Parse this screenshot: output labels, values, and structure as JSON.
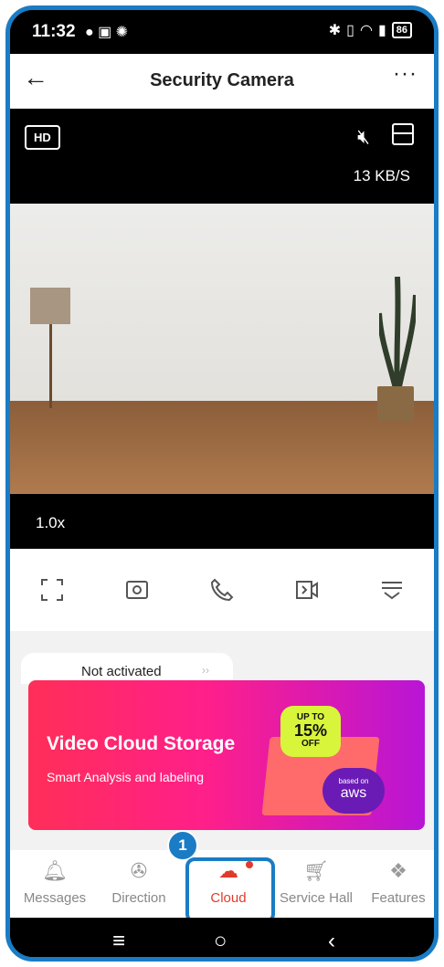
{
  "status_bar": {
    "time": "11:32",
    "battery": "86"
  },
  "header": {
    "title": "Security Camera",
    "back_label": "←",
    "more_label": "···"
  },
  "video": {
    "quality_badge": "HD",
    "bitrate": "13 KB/S",
    "zoom": "1.0x"
  },
  "controls": [
    "fullscreen",
    "screenshot",
    "call",
    "record",
    "more"
  ],
  "cloud_panel": {
    "status": "Not activated",
    "banner_title": "Video Cloud Storage",
    "banner_subtitle": "Smart Analysis and labeling",
    "promo": {
      "line1": "UP TO",
      "line2": "15%",
      "line3": "OFF"
    },
    "partner": {
      "based_on": "based on",
      "name": "aws"
    }
  },
  "bottom_nav": [
    {
      "label": "Messages"
    },
    {
      "label": "Direction"
    },
    {
      "label": "Cloud"
    },
    {
      "label": "Service Hall"
    },
    {
      "label": "Features"
    }
  ],
  "annotation": {
    "step": "1"
  },
  "colors": {
    "accent": "#e23a2a",
    "highlight": "#1a7cc4"
  }
}
